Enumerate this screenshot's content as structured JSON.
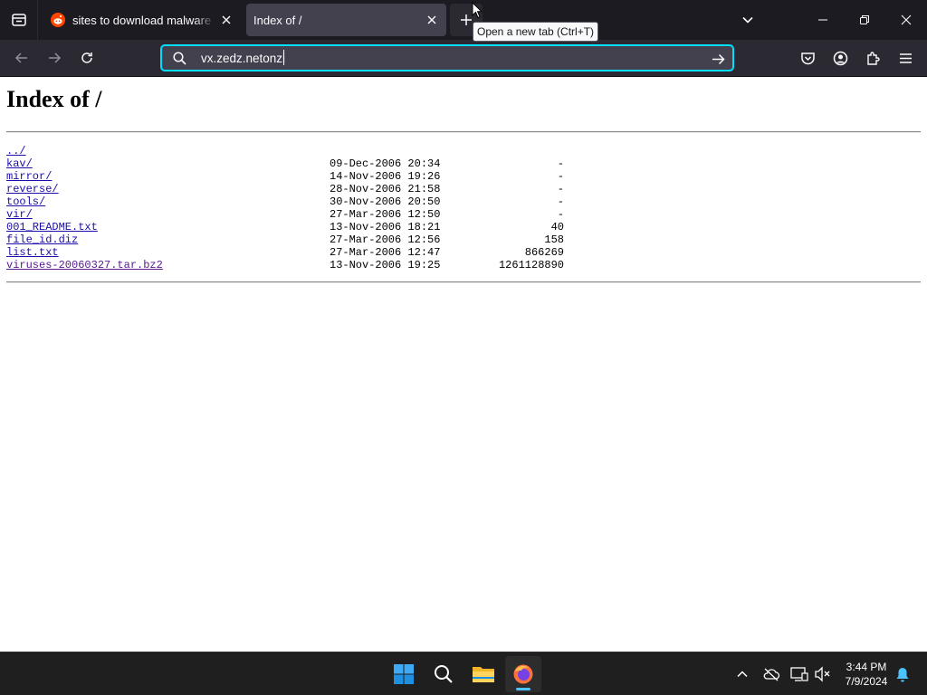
{
  "browser": {
    "tabs": [
      {
        "title": "sites to download malware : r/h",
        "active": false,
        "favicon": "reddit-icon"
      },
      {
        "title": "Index of /",
        "active": true
      }
    ],
    "tooltip": "Open a new tab (Ctrl+T)",
    "url_value": "vx.zedz.netonzi"
  },
  "page": {
    "heading": "Index of /",
    "entries": [
      {
        "name": "../",
        "date": "",
        "size": "",
        "visited": false
      },
      {
        "name": "kav/",
        "date": "09-Dec-2006 20:34",
        "size": "-",
        "visited": false
      },
      {
        "name": "mirror/",
        "date": "14-Nov-2006 19:26",
        "size": "-",
        "visited": false
      },
      {
        "name": "reverse/",
        "date": "28-Nov-2006 21:58",
        "size": "-",
        "visited": false
      },
      {
        "name": "tools/",
        "date": "30-Nov-2006 20:50",
        "size": "-",
        "visited": false
      },
      {
        "name": "vir/",
        "date": "27-Mar-2006 12:50",
        "size": "-",
        "visited": false
      },
      {
        "name": "001_README.txt",
        "date": "13-Nov-2006 18:21",
        "size": "40",
        "visited": false
      },
      {
        "name": "file_id.diz",
        "date": "27-Mar-2006 12:56",
        "size": "158",
        "visited": false
      },
      {
        "name": "list.txt",
        "date": "27-Mar-2006 12:47",
        "size": "866269",
        "visited": false
      },
      {
        "name": "viruses-20060327.tar.bz2",
        "date": "13-Nov-2006 19:25",
        "size": "1261128890",
        "visited": true
      }
    ]
  },
  "taskbar": {
    "time": "3:44 PM",
    "date": "7/9/2024",
    "pinned": [
      "windows-start-icon",
      "search-icon",
      "file-explorer-icon",
      "firefox-icon"
    ],
    "active_app": "firefox-icon"
  },
  "colors": {
    "link": "#1a0dab",
    "visited_link": "#551a8b",
    "urlbar_focus": "#00ddff",
    "taskbar_indicator": "#4cc2ff"
  }
}
